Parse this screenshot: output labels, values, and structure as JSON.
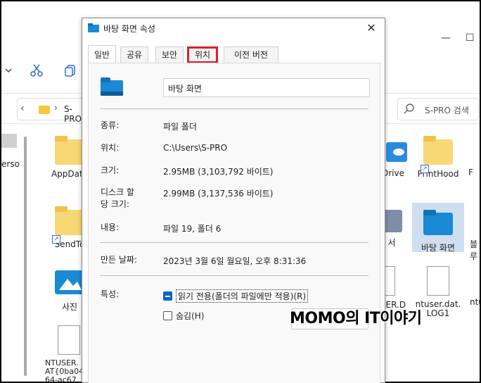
{
  "explorer": {
    "address_path": "S-PRO",
    "search_placeholder": "S-PRO 검색",
    "nav_label": "erso",
    "items": {
      "appdata": "AppData",
      "sendto": "SendTo",
      "photos": "사진",
      "ntuser": "NTUSER.\nAT{0ba04\n64-ac67",
      "onedrive": "Drive",
      "printhood": "PrintHood",
      "desktop": "바탕 화면",
      "partial_right": "블루",
      "partial_f": "F",
      "partial_seo": "서",
      "ser_d": "SER.D",
      "ntuser_dat": "ntuser.dat.\nLOG1",
      "partial_ntu": "ntu"
    }
  },
  "dialog": {
    "title": "바탕 화면 속성",
    "tabs": [
      "일반",
      "공유",
      "보안",
      "위치",
      "이전 버전"
    ],
    "active_tab": "일반",
    "highlighted_tab": "위치",
    "folder_name": "바탕 화면",
    "fields": {
      "type_label": "종류:",
      "type_value": "파일 폴더",
      "location_label": "위치:",
      "location_value": "C:\\Users\\S-PRO",
      "size_label": "크기:",
      "size_value": "2.95MB (3,103,792 바이트)",
      "disk_size_label": "디스크 할\n당 크기:",
      "disk_size_value": "2.99MB (3,137,536 바이트)",
      "contains_label": "내용:",
      "contains_value": "파일 19, 폴더 6",
      "created_label": "만든 날짜:",
      "created_value": "2023년 3월 6일 월요일, 오후 8:31:36",
      "attributes_label": "특성:"
    },
    "readonly_label": "읽기 전용(폴더의 파일에만 적용)(R)",
    "hidden_label": "숨김(H)"
  },
  "watermark": "MOMO의 IT이야기",
  "colors": {
    "accent": "#0067c0",
    "highlight_border": "#e01f26",
    "folder_yellow": "#f8d775",
    "desktop_folder_blue": "#1a8ad4"
  }
}
